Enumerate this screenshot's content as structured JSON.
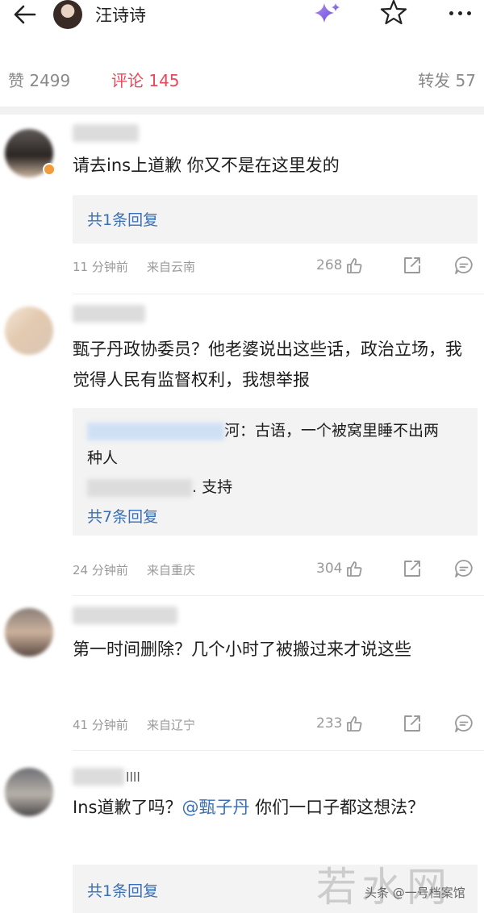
{
  "header": {
    "back_icon": "arrow-left-icon",
    "username": "汪诗诗",
    "sparkle_icon": "sparkle-icon",
    "star_icon": "star-icon",
    "more_icon": "more-dots-icon"
  },
  "tabs": {
    "likes": "赞 2499",
    "comments": "评论 145",
    "reposts": "转发 57"
  },
  "colors": {
    "active_tab": "#e8485a",
    "link": "#3a6fb5",
    "muted": "#9a9a9a"
  },
  "comments": [
    {
      "text": "请去ins上道歉 你又不是在这里发的",
      "reply_link": "共1条回复",
      "time": "11 分钟前",
      "location": "来自云南",
      "likes": "268"
    },
    {
      "text": "甄子丹政协委员？他老婆说出这些话，政治立场，我觉得人民有监督权利，我想举报",
      "replies": [
        {
          "visible_suffix": "河：古语，一个被窝里睡不出两"
        },
        {
          "visible_suffix": "种人"
        },
        {
          "visible_suffix": ". 支持"
        }
      ],
      "reply_link": "共7条回复",
      "time": "24 分钟前",
      "location": "来自重庆",
      "likes": "304"
    },
    {
      "text": "第一时间删除？几个小时了被搬过来才说这些",
      "time": "41 分钟前",
      "location": "来自辽宁",
      "likes": "233"
    },
    {
      "username_suffix": "llll",
      "text_before": "Ins道歉了吗？",
      "mention": "@甄子丹",
      "text_after": " 你们一口子都这想法？",
      "reply_link": "共1条回复"
    }
  ],
  "watermark": "若水网",
  "source_label": "头条 @一号档案馆"
}
